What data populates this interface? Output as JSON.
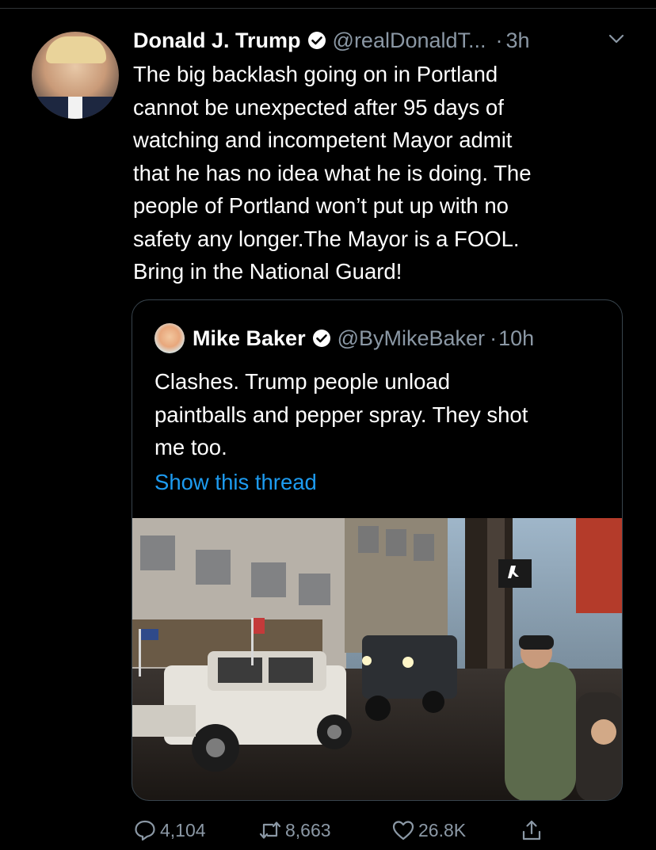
{
  "tweet": {
    "author_name": "Donald J. Trump",
    "author_handle": "@realDonaldT...",
    "separator": "·",
    "time": "3h",
    "verified": true,
    "text": "The big backlash going on in Portland\ncannot be unexpected after 95 days of\nwatching and incompetent Mayor admit\nthat he has no idea what he is doing. The\npeople of Portland won’t put up with no\nsafety any longer.The Mayor is a FOOL.\nBring in the National Guard!"
  },
  "quoted_tweet": {
    "author_name": "Mike Baker",
    "author_handle": "@ByMikeBaker",
    "separator": "·",
    "time": "10h",
    "verified": true,
    "text": "Clashes. Trump people unload\npaintballs and pepper spray. They shot\nme too.",
    "show_thread_label": "Show this thread"
  },
  "actions": {
    "replies": "4,104",
    "retweets": "8,663",
    "likes": "26.8K"
  },
  "icons": {
    "verified": "verified-badge-icon",
    "more": "chevron-down-icon",
    "reply": "reply-icon",
    "retweet": "retweet-icon",
    "like": "heart-icon",
    "share": "share-icon"
  },
  "colors": {
    "background": "#000000",
    "text": "#ffffff",
    "secondary": "#8b98a5",
    "link": "#1d9bf0",
    "border": "#38444d"
  }
}
